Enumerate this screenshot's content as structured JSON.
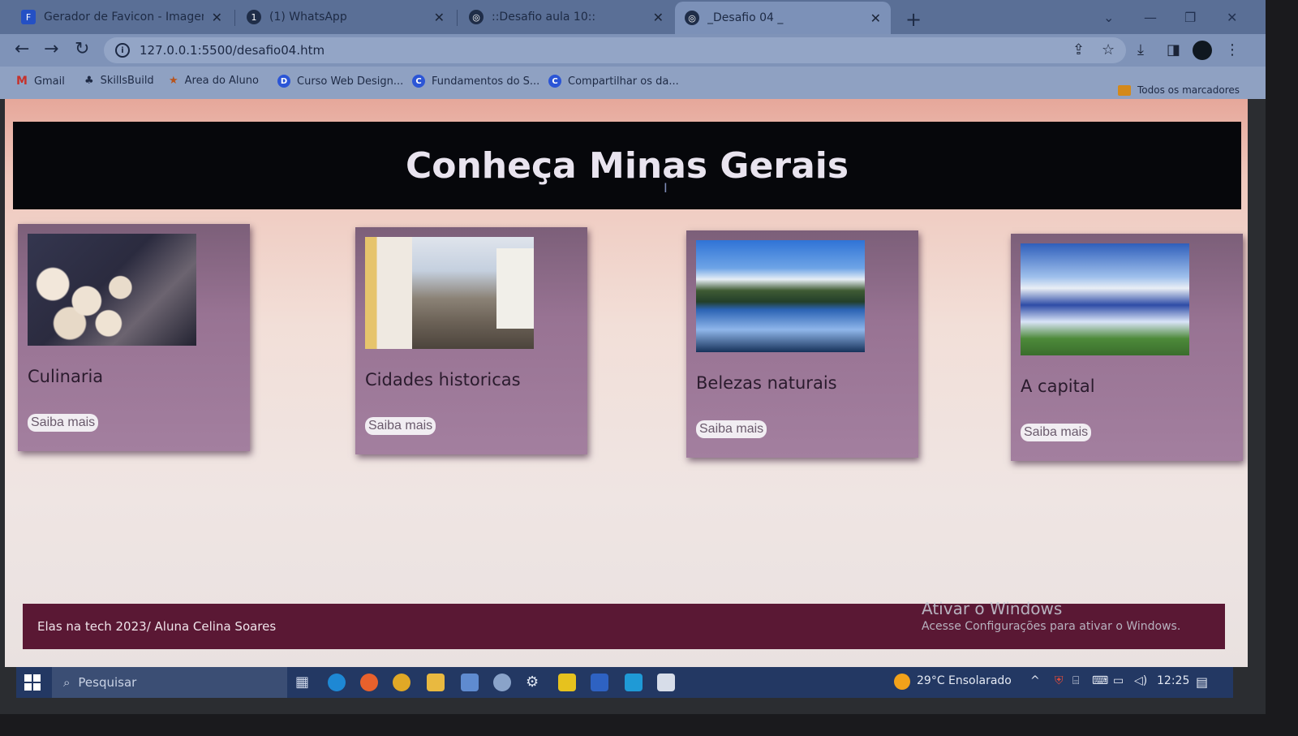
{
  "browser": {
    "tabs": [
      {
        "title": "Gerador de Favicon - Imagem pa",
        "icon": "F"
      },
      {
        "title": "(1) WhatsApp",
        "icon": "1"
      },
      {
        "title": "::Desafio aula 10::",
        "icon": "◎"
      },
      {
        "title": "_Desafio 04 _",
        "icon": "◎",
        "active": true
      }
    ],
    "new_tab": "+",
    "url": "127.0.0.1:5500/desafio04.htm",
    "bookmarks": [
      {
        "label": "Gmail",
        "icon": "M"
      },
      {
        "label": "SkillsBuild",
        "icon": "♣"
      },
      {
        "label": "Area do Aluno",
        "icon": "★"
      },
      {
        "label": "Curso Web Design...",
        "icon": "D"
      },
      {
        "label": "Fundamentos do S...",
        "icon": "C"
      },
      {
        "label": "Compartilhar os da...",
        "icon": "C"
      }
    ],
    "all_bookmarks": "Todos os marcadores"
  },
  "page": {
    "title": "Conheça Minas Gerais",
    "cards": [
      {
        "title": "Culinaria",
        "button": "Saiba mais"
      },
      {
        "title": "Cidades historicas",
        "button": "Saiba mais"
      },
      {
        "title": "Belezas naturais",
        "button": "Saiba mais"
      },
      {
        "title": "A capital",
        "button": "Saiba mais"
      }
    ],
    "footer": "Elas na tech 2023/ Aluna Celina Soares"
  },
  "watermark": {
    "line1": "Ativar o Windows",
    "line2": "Acesse Configurações para ativar o Windows."
  },
  "taskbar": {
    "search_placeholder": "Pesquisar",
    "weather": "29°C  Ensolarado",
    "time": "12:25"
  }
}
